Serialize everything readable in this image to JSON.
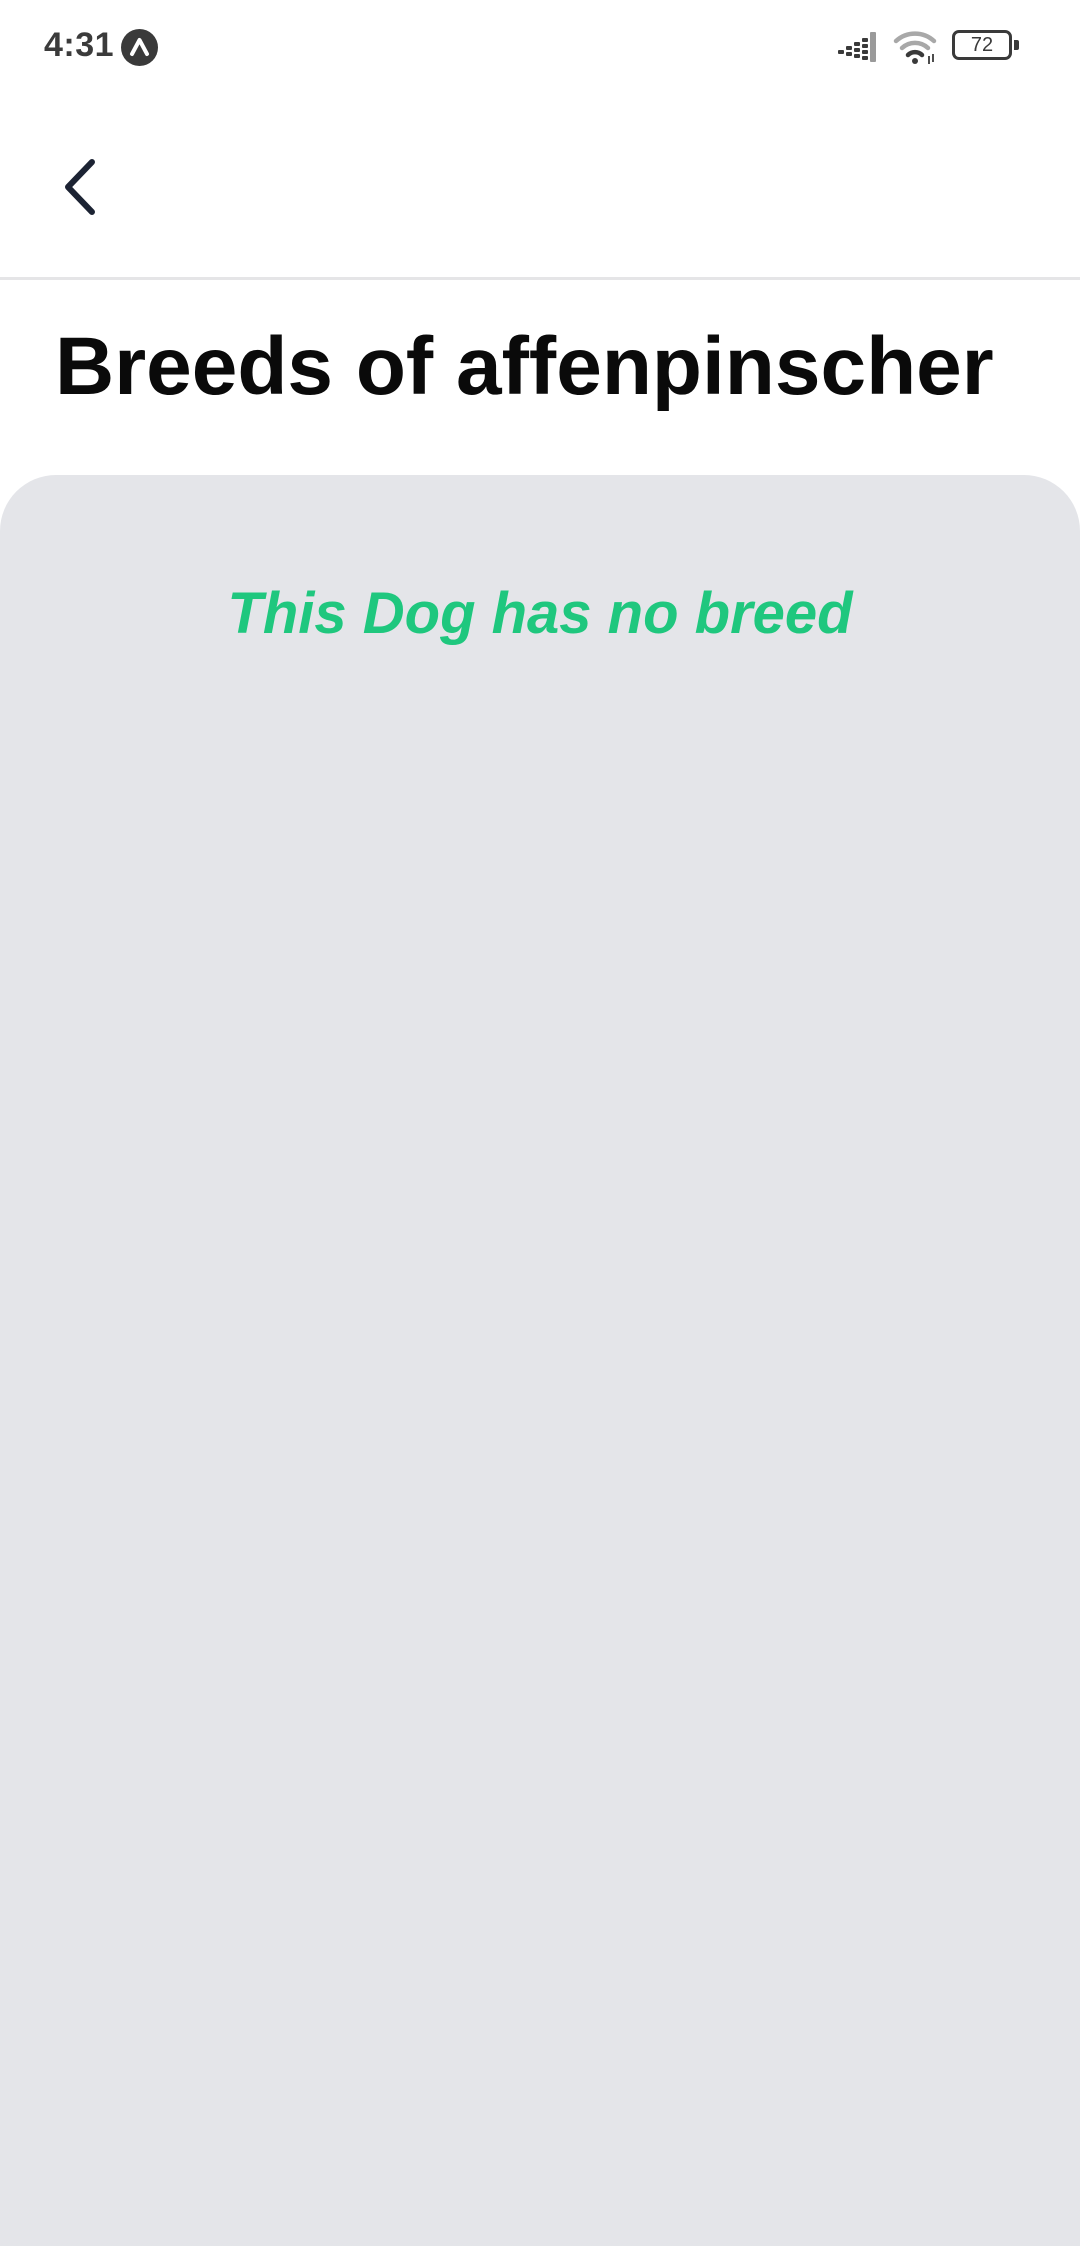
{
  "status_bar": {
    "time": "4:31",
    "battery_level": "72",
    "icons": [
      "app-notification-icon",
      "signal-icon",
      "wifi-icon",
      "battery-icon"
    ]
  },
  "header": {
    "back_icon": "chevron-left-icon"
  },
  "page": {
    "title": "Breeds of affenpinscher",
    "empty_message": "This Dog has no breed"
  },
  "colors": {
    "accent": "#1fc77e",
    "panel_background": "#e4e5e9",
    "title_text": "#0a0a0a",
    "back_icon": "#1c2333"
  }
}
